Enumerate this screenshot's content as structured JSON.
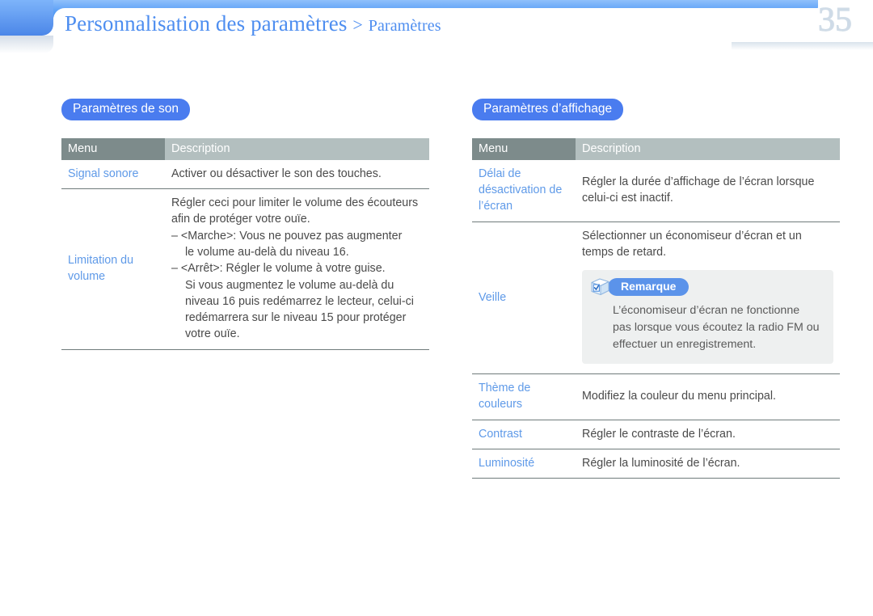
{
  "header": {
    "breadcrumb_parent": "Personnalisation des paramètres",
    "breadcrumb_separator": ">",
    "breadcrumb_current": "Paramètres",
    "page_number": "35",
    "accent_color": "#4e8ef0",
    "bar_color": "#62a4f7"
  },
  "sections": [
    {
      "pill_label": "Paramètres de son",
      "pill_color": "#4a7cef",
      "columns": {
        "menu": "Menu",
        "description": "Description"
      },
      "header_menu_color": "#7d8b8b",
      "header_desc_color": "#b3bfbf",
      "rows": [
        {
          "menu": "Signal sonore",
          "lines": [
            {
              "type": "line",
              "text": "Activer ou désactiver le son des touches."
            }
          ]
        },
        {
          "menu": "Limitation du volume",
          "lines": [
            {
              "type": "line",
              "text": "Régler ceci pour limiter le volume des écouteurs"
            },
            {
              "type": "line",
              "text": "afin de protéger votre ouïe."
            },
            {
              "type": "bullet",
              "text": "– <Marche>: Vous ne pouvez pas augmenter"
            },
            {
              "type": "cont",
              "text": "le volume au-delà du niveau 16."
            },
            {
              "type": "bullet",
              "text": "– <Arrêt>: Régler le volume à votre guise."
            },
            {
              "type": "cont",
              "text": "Si vous augmentez le volume au-delà du"
            },
            {
              "type": "cont",
              "text": "niveau 16 puis redémarrez le lecteur, celui-ci"
            },
            {
              "type": "cont",
              "text": "redémarrera sur le niveau 15 pour protéger"
            },
            {
              "type": "cont",
              "text": "votre ouïe."
            }
          ]
        }
      ]
    },
    {
      "pill_label": "Paramètres d’affichage",
      "pill_color": "#4a7cef",
      "columns": {
        "menu": "Menu",
        "description": "Description"
      },
      "header_menu_color": "#7d8b8b",
      "header_desc_color": "#b3bfbf",
      "rows": [
        {
          "menu": "Délai de désactivation de l’écran",
          "lines": [
            {
              "type": "line",
              "text": "Régler la durée d’affichage de l’écran lorsque"
            },
            {
              "type": "line",
              "text": "celui-ci est inactif."
            }
          ]
        },
        {
          "menu": "Veille",
          "lines": [
            {
              "type": "line",
              "text": "Sélectionner un économiseur d’écran et un"
            },
            {
              "type": "line",
              "text": "temps de retard."
            }
          ],
          "note": {
            "icon": "note-cube-check-icon",
            "tag": "Remarque",
            "tag_color": "#5b93ea",
            "background": "#eef0f0",
            "body": [
              "L’économiseur d’écran ne fonctionne",
              "pas lorsque vous écoutez la radio FM ou",
              "effectuer un enregistrement."
            ]
          }
        },
        {
          "menu": "Thème de couleurs",
          "lines": [
            {
              "type": "line",
              "text": "Modifiez la couleur du menu principal."
            }
          ]
        },
        {
          "menu": "Contrast",
          "lines": [
            {
              "type": "line",
              "text": "Régler le contraste de l’écran."
            }
          ]
        },
        {
          "menu": "Luminosité",
          "lines": [
            {
              "type": "line",
              "text": "Régler la luminosité de l’écran."
            }
          ]
        }
      ]
    }
  ]
}
